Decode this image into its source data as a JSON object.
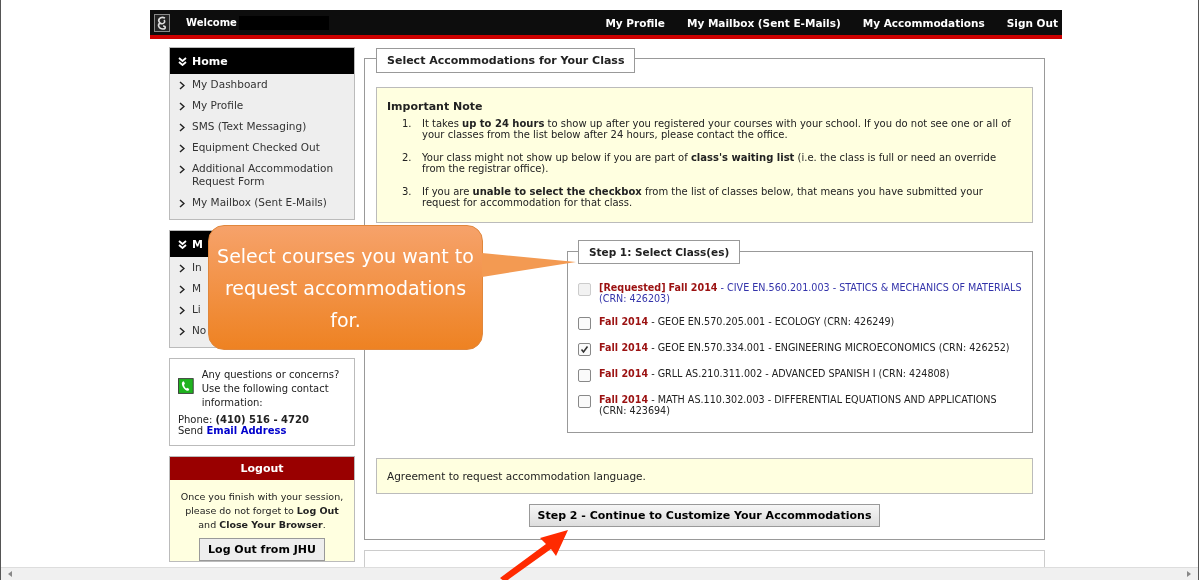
{
  "top_bar": {
    "welcome": "Welcome",
    "nav": [
      "My Profile",
      "My Mailbox (Sent E-Mails)",
      "My Accommodations",
      "Sign Out"
    ]
  },
  "sidebar": {
    "menus": [
      {
        "title": "Home",
        "items": [
          "My Dashboard",
          "My Profile",
          "SMS (Text Messaging)",
          "Equipment Checked Out",
          "Additional Accommodation Request Form",
          "My Mailbox (Sent E-Mails)"
        ]
      },
      {
        "title": "M",
        "items": [
          "In",
          "M",
          "Li",
          "No"
        ]
      }
    ],
    "contact": {
      "text": "Any questions or concerns? Use the following contact information:",
      "phone_label": "Phone:",
      "phone": "(410) 516 - 4720",
      "send_label": "Send",
      "email_link": "Email Address"
    },
    "logout": {
      "title": "Logout",
      "text": "Once you finish with your session, please do not forget to **Log Out** and **Close Your Browser**.",
      "button": "Log Out from JHU"
    }
  },
  "main": {
    "title": "Select Accommodations for Your Class",
    "note": {
      "title": "Important Note",
      "items": [
        {
          "number": "1.",
          "text": "It takes **up to 24 hours** to show up after you registered your courses with your school. If you do not see one or all of your classes from the list below after 24 hours, please contact the office."
        },
        {
          "number": "2.",
          "text": "Your class might not show up below if you are part of **class's waiting list** (i.e. the class is full or need an override from the registrar office)."
        },
        {
          "number": "3.",
          "text": "If you are **unable to select the checkbox** from the list of classes below, that means you have submitted your request for accommodation for that class."
        }
      ]
    },
    "step1": {
      "title": "Step 1: Select Class(es)",
      "classes": [
        {
          "status": "[Requested]",
          "term": "Fall 2014",
          "course": "- CIVE EN.560.201.003 - STATICS & MECHANICS OF MATERIALS (CRN: 426203)",
          "checked": false,
          "disabled": true
        },
        {
          "term": "Fall 2014",
          "course": "- GEOE EN.570.205.001 - ECOLOGY (CRN: 426249)",
          "checked": false,
          "disabled": false
        },
        {
          "term": "Fall 2014",
          "course": "- GEOE EN.570.334.001 - ENGINEERING MICROECONOMICS (CRN: 426252)",
          "checked": true,
          "disabled": false
        },
        {
          "term": "Fall 2014",
          "course": "- GRLL AS.210.311.002 - ADVANCED SPANISH I (CRN: 424808)",
          "checked": false,
          "disabled": false
        },
        {
          "term": "Fall 2014",
          "course": "- MATH AS.110.302.003 - DIFFERENTIAL EQUATIONS AND APPLICATIONS (CRN: 423694)",
          "checked": false,
          "disabled": false
        }
      ]
    },
    "agreement": "Agreement to request accommodation language.",
    "continue_button": "Step 2 - Continue to Customize Your Accommodations"
  },
  "callout": "Select courses you want to request accommodations for."
}
